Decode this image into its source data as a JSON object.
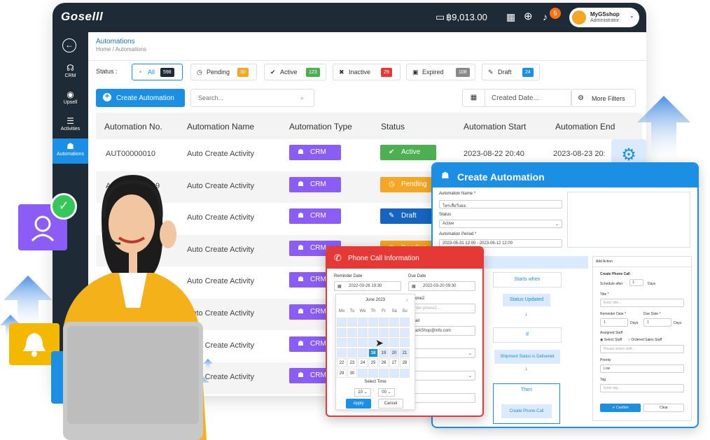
{
  "topbar": {
    "logo": "Goselll",
    "balance": "฿9,013.00",
    "notifications": "5",
    "shop_name": "MyGSshop",
    "shop_role": "Administrator"
  },
  "sidebar": {
    "items": [
      {
        "label": "CRM",
        "icon": "headset-icon"
      },
      {
        "label": "Upsell",
        "icon": "signal-icon"
      },
      {
        "label": "Activities",
        "icon": "list-icon"
      },
      {
        "label": "Automations",
        "icon": "robot-icon"
      }
    ]
  },
  "page": {
    "title": "Automations",
    "breadcrumb": "Home / Automations"
  },
  "status_filter": {
    "label": "Status :",
    "chips": [
      {
        "label": "All",
        "count": "598",
        "color": "#1f2a37",
        "icon": "◔"
      },
      {
        "label": "Pending",
        "count": "30",
        "color": "#f5a623",
        "icon": "◷"
      },
      {
        "label": "Active",
        "count": "123",
        "color": "#4caf50",
        "icon": "✔"
      },
      {
        "label": "Inactive",
        "count": "29",
        "color": "#e53935",
        "icon": "✖"
      },
      {
        "label": "Expired",
        "count": "108",
        "color": "#888888",
        "icon": "▣"
      },
      {
        "label": "Draft",
        "count": "24",
        "color": "#1a8fe3",
        "icon": "✎"
      }
    ]
  },
  "toolbar": {
    "create_label": "Create Automation",
    "search_placeholder": "Search...",
    "date_label": "Created Date...",
    "filters_label": "More Filters"
  },
  "table": {
    "columns": [
      "Automation No.",
      "Automation Name",
      "Automation Type",
      "Status",
      "Automation Start",
      "Automation End"
    ],
    "rows": [
      {
        "no": "AUT00000010",
        "name": "Auto Create Activity",
        "type": "CRM",
        "status": "Active",
        "status_color": "#4caf50",
        "start": "2023-08-22 20:40",
        "end": "2023-08-23 20:"
      },
      {
        "no": "AUT000000009",
        "name": "Auto Create Activity",
        "type": "CRM",
        "status": "Pending",
        "status_color": "#f5a623",
        "start": "",
        "end": ""
      },
      {
        "no": "",
        "name": "Auto Create Activity",
        "type": "CRM",
        "status": "Draft",
        "status_color": "#1565c0",
        "start": "",
        "end": ""
      },
      {
        "no": "AUT000000007",
        "name": "Auto Create Activity",
        "type": "CRM",
        "status": "Pending",
        "status_color": "#f5a623",
        "start": "",
        "end": ""
      },
      {
        "no": "",
        "name": "Auto Create Activity",
        "type": "CRM",
        "status": "",
        "status_color": "",
        "start": "",
        "end": ""
      },
      {
        "no": "",
        "name": "Auto Create Activity",
        "type": "CRM",
        "status": "",
        "status_color": "",
        "start": "",
        "end": ""
      },
      {
        "no": "",
        "name": "Auto Create Activity",
        "type": "CRM",
        "status": "",
        "status_color": "",
        "start": "",
        "end": ""
      },
      {
        "no": "",
        "name": "Auto Create Activity",
        "type": "CRM",
        "status": "",
        "status_color": "",
        "start": "",
        "end": ""
      }
    ]
  },
  "create_panel": {
    "title": "Create Automation",
    "name_label": "Automation Name *",
    "name_value": "โทรเสื่อวิ่งออ",
    "status_label": "Status",
    "status_value": "Active",
    "period_label": "Automation Period *",
    "period_value": "2023-05-31 12:00 - 2023-06-12 12:00",
    "flow": {
      "starts": "Starts when",
      "updated": "Status Updated",
      "if": "If",
      "shipment": "Shipment Status is Delivered",
      "then": "Then",
      "action": "Create Phone Call"
    },
    "add_action": {
      "title": "Add Action",
      "subtitle": "Create Phone Call",
      "schedule_label": "Schedule after",
      "schedule_value": "1",
      "days": "Days",
      "title_label": "Title *",
      "title_placeholder": "Enter title...",
      "reminder_label": "Reminder Date *",
      "due_label": "Due Date *",
      "reminder_value": "1",
      "due_value": "1",
      "assigned_label": "Assigned Staff",
      "radio1": "Select Staff",
      "radio2": "Ordered Sales Staff",
      "staff_placeholder": "Please select staff...",
      "priority_label": "Priority",
      "priority_value": "Low",
      "tag_label": "Tag",
      "tag_placeholder": "Enter tag...",
      "confirm": "Confirm",
      "clear": "Clear"
    }
  },
  "phone_call": {
    "title": "Phone Call Information",
    "reminder_label": "Reminder Date",
    "reminder_value": "2022-03-26 19:30",
    "due_label": "Due Date",
    "due_value": "2022-03-20 09:30",
    "phone2_label": "one2",
    "phone2_placeholder": "Enter phone2...",
    "email_label": "ail",
    "email_value": "MarkShop@info.com",
    "calendar": {
      "month": "June 2023",
      "weekdays": [
        "Mo",
        "Tu",
        "We",
        "Th",
        "Fr",
        "Sa",
        "Su"
      ],
      "rows": [
        [
          "",
          "",
          "",
          "",
          "",
          "",
          ""
        ],
        [
          "",
          "",
          "",
          "",
          "",
          "",
          ""
        ],
        [
          "",
          "",
          "",
          "",
          "",
          "",
          ""
        ],
        [
          "",
          "",
          "",
          "",
          "18",
          "19",
          "20",
          "21"
        ],
        [
          "22",
          "23",
          "24",
          "25",
          "26",
          "27",
          "28"
        ],
        [
          "29",
          "30",
          "",
          "",
          "",
          "",
          ""
        ]
      ],
      "selected": "18",
      "select_time": "Select Time",
      "hour": "10",
      "minute": "00",
      "apply": "Apply",
      "cancel": "Cancel"
    }
  }
}
